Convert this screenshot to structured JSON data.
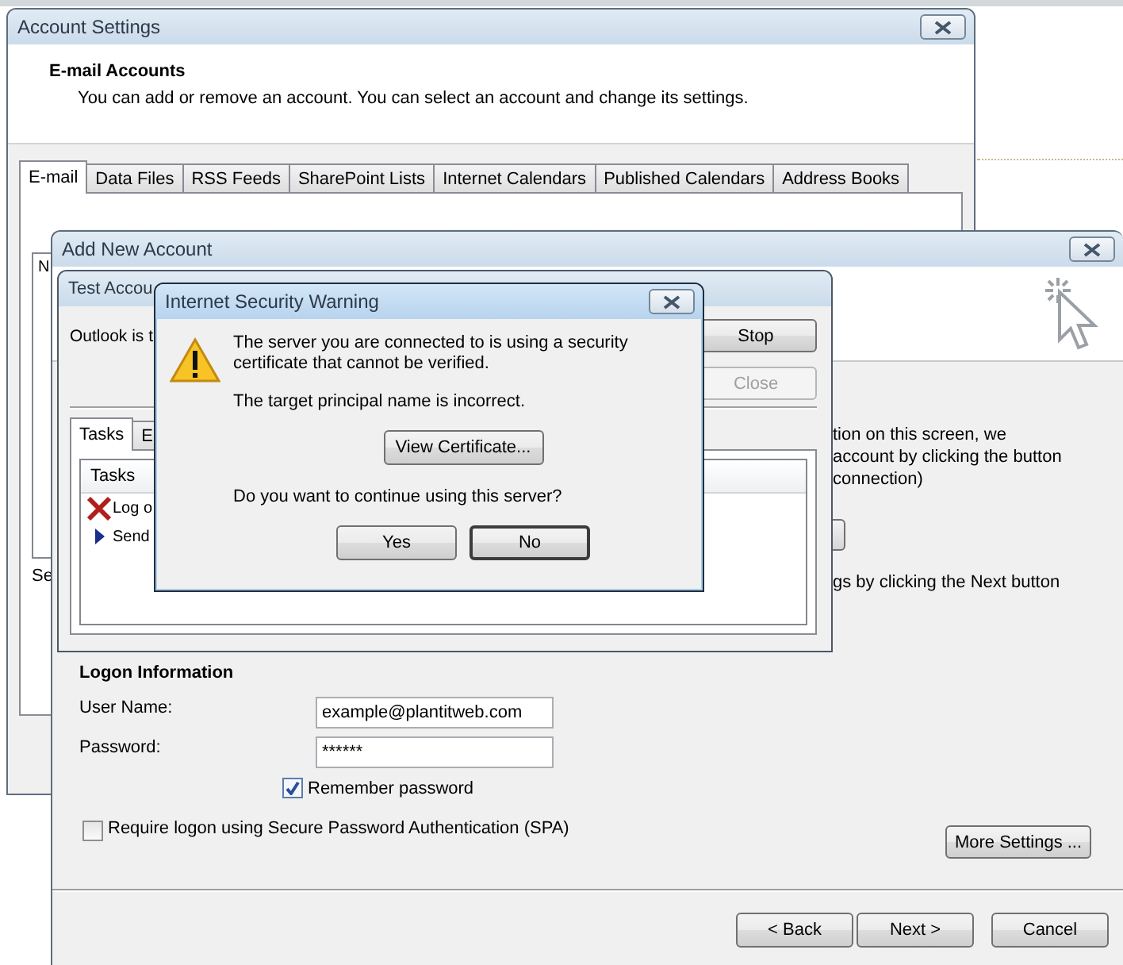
{
  "account_settings": {
    "title": "Account Settings",
    "heading": "E-mail Accounts",
    "description": "You can add or remove an account. You can select an account and change its settings.",
    "tabs": [
      {
        "label": "E-mail",
        "selected": true
      },
      {
        "label": "Data Files",
        "selected": false
      },
      {
        "label": "RSS Feeds",
        "selected": false
      },
      {
        "label": "SharePoint Lists",
        "selected": false
      },
      {
        "label": "Internet Calendars",
        "selected": false
      },
      {
        "label": "Published Calendars",
        "selected": false
      },
      {
        "label": "Address Books",
        "selected": false
      }
    ],
    "list_header": "N",
    "footer_text": "Se"
  },
  "add_account": {
    "title": "Add New Account",
    "notes": [
      "tion on this screen, we",
      "account by clicking the button",
      "connection)"
    ],
    "next_note": "gs by clicking the Next button",
    "logon": {
      "heading": "Logon Information",
      "user_label": "User Name:",
      "user_value": "example@plantitweb.com",
      "password_label": "Password:",
      "password_value": "******"
    },
    "remember": {
      "label": "Remember password",
      "checked": true
    },
    "spa": {
      "label": "Require logon using Secure Password Authentication (SPA)",
      "checked": false
    },
    "more_button": "More Settings ...",
    "nav_buttons": [
      "< Back",
      "Next >",
      "Cancel"
    ]
  },
  "test_settings": {
    "title": "Test Accou",
    "status": "Outlook is t",
    "buttons": [
      {
        "label": "Stop",
        "disabled": false
      },
      {
        "label": "Close",
        "disabled": true
      }
    ],
    "tabs": [
      {
        "label": "Tasks",
        "selected": true
      },
      {
        "label": "E",
        "selected": false
      }
    ],
    "list_header": "Tasks",
    "rows": [
      {
        "kind": "error",
        "text": "Log o"
      },
      {
        "kind": "pending",
        "text": "Send"
      }
    ]
  },
  "warning": {
    "title": "Internet Security Warning",
    "message": "The server you are connected to is using a security certificate that cannot be verified.",
    "detail": "The target principal name is incorrect.",
    "certificate_button": "View Certificate...",
    "question": "Do you want to continue using this server?",
    "buttons": [
      "Yes",
      "No"
    ]
  }
}
